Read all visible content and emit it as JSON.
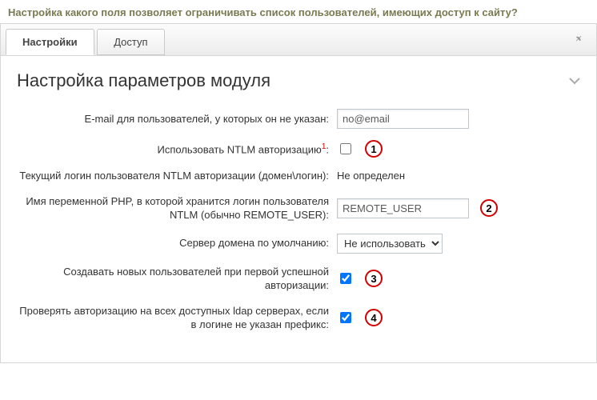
{
  "question": "Настройка какого поля позволяет ограничивать список пользователей, имеющих доступ к сайту?",
  "tabs": {
    "settings": "Настройки",
    "access": "Доступ"
  },
  "panel": {
    "title": "Настройка параметров модуля"
  },
  "rows": {
    "email_label": "E-mail для пользователей, у которых он не указан:",
    "email_value": "no@email",
    "ntlm_label": "Использовать NTLM авторизацию",
    "ntlm_sup": "1",
    "ntlm_login_label": "Текущий логин пользователя NTLM авторизации (домен\\логин):",
    "ntlm_login_value": "Не определен",
    "php_var_label": "Имя переменной PHP, в которой хранится логин пользователя NTLM (обычно REMOTE_USER):",
    "php_var_value": "REMOTE_USER",
    "domain_server_label": "Сервер домена по умолчанию:",
    "domain_server_value": "Не использовать",
    "create_users_label": "Создавать новых пользователей при первой успешной авторизации:",
    "ldap_servers_label": "Проверять авторизацию на всех доступных ldap серверах, если в логине не указан префикс:"
  },
  "markers": {
    "m1": "1",
    "m2": "2",
    "m3": "3",
    "m4": "4"
  }
}
